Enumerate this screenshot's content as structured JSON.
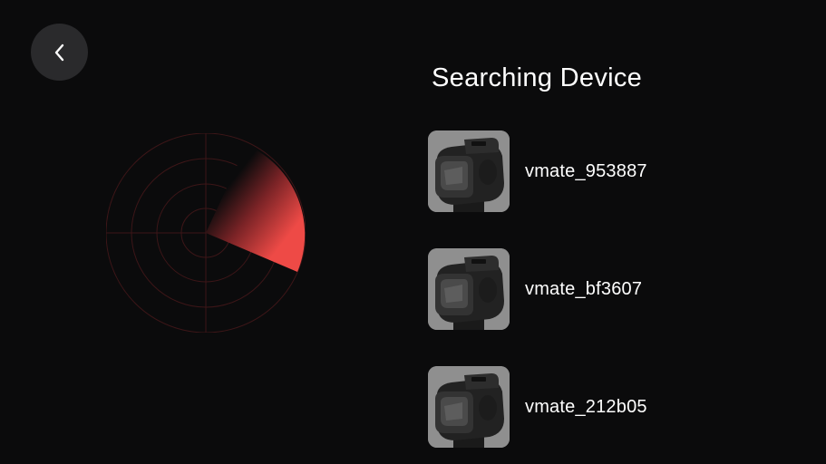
{
  "header": {
    "back_icon": "chevron-left-icon",
    "title": "Searching Device"
  },
  "radar": {
    "icon": "radar-scan-icon",
    "accent_color": "#e8423f",
    "ring_color": "#4a1a1c"
  },
  "devices": [
    {
      "name": "vmate_953887",
      "thumbnail": "gimbal-camera-icon"
    },
    {
      "name": "vmate_bf3607",
      "thumbnail": "gimbal-camera-icon"
    },
    {
      "name": "vmate_212b05",
      "thumbnail": "gimbal-camera-icon"
    }
  ]
}
